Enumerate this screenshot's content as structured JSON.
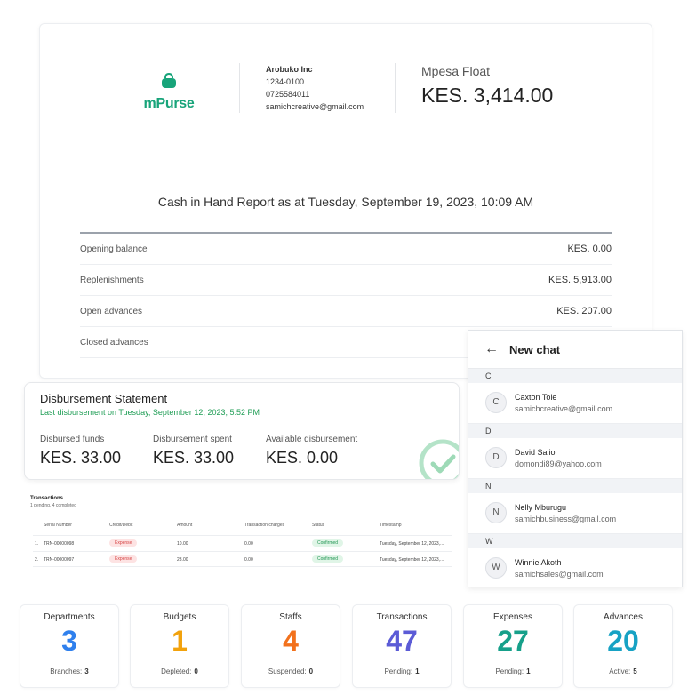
{
  "report": {
    "logo_text": "mPurse",
    "company": {
      "name": "Arobuko Inc",
      "box": "1234-0100",
      "phone": "0725584011",
      "email": "samichcreative@gmail.com"
    },
    "float_label": "Mpesa Float",
    "float_value": "KES. 3,414.00",
    "title": "Cash in Hand Report as at Tuesday, September 19, 2023, 10:09 AM",
    "rows": [
      {
        "label": "Opening balance",
        "value": "KES. 0.00"
      },
      {
        "label": "Replenishments",
        "value": "KES. 5,913.00"
      },
      {
        "label": "Open advances",
        "value": "KES. 207.00"
      },
      {
        "label": "Closed advances",
        "value": ""
      }
    ]
  },
  "disbursement": {
    "title": "Disbursement Statement",
    "subtitle": "Last disbursement on Tuesday, September 12, 2023, 5:52 PM",
    "stats": [
      {
        "label": "Disbursed funds",
        "value": "KES. 33.00"
      },
      {
        "label": "Disbursement spent",
        "value": "KES. 33.00"
      },
      {
        "label": "Available disbursement",
        "value": "KES. 0.00"
      }
    ],
    "check_color": "#27ae60"
  },
  "transactions": {
    "title": "Transactions",
    "subtitle": "1 pending, 4 completed",
    "columns": [
      "Serial Number",
      "Credit/Debit",
      "Amount",
      "Transaction charges",
      "Status",
      "Timestamp"
    ],
    "rows": [
      {
        "index": "1.",
        "serial": "TRN-00000098",
        "type": "Expense",
        "amount": "10.00",
        "charges": "0.00",
        "status": "Confirmed",
        "timestamp": "Tuesday, September 12, 2023,..."
      },
      {
        "index": "2.",
        "serial": "TRN-00000097",
        "type": "Expense",
        "amount": "23.00",
        "charges": "0.00",
        "status": "Confirmed",
        "timestamp": "Tuesday, September 12, 2023,..."
      }
    ]
  },
  "chat": {
    "back_icon": "arrow-left-icon",
    "title": "New chat",
    "sections": [
      {
        "letter": "C",
        "contact": {
          "initial": "C",
          "name": "Caxton Tole",
          "email": "samichcreative@gmail.com"
        }
      },
      {
        "letter": "D",
        "contact": {
          "initial": "D",
          "name": "David Salio",
          "email": "domondi89@yahoo.com"
        }
      },
      {
        "letter": "N",
        "contact": {
          "initial": "N",
          "name": "Nelly Mburugu",
          "email": "samichbusiness@gmail.com"
        }
      },
      {
        "letter": "W",
        "contact": {
          "initial": "W",
          "name": "Winnie Akoth",
          "email": "samichsales@gmail.com"
        }
      }
    ]
  },
  "stats": [
    {
      "title": "Departments",
      "value": "3",
      "color": "#2f80ed",
      "footer_label": "Branches:",
      "footer_value": "3"
    },
    {
      "title": "Budgets",
      "value": "1",
      "color": "#f2a20c",
      "footer_label": "Depleted:",
      "footer_value": "0"
    },
    {
      "title": "Staffs",
      "value": "4",
      "color": "#f2711c",
      "footer_label": "Suspended:",
      "footer_value": "0"
    },
    {
      "title": "Transactions",
      "value": "47",
      "color": "#5b5bd6",
      "footer_label": "Pending:",
      "footer_value": "1"
    },
    {
      "title": "Expenses",
      "value": "27",
      "color": "#16a08a",
      "footer_label": "Pending:",
      "footer_value": "1"
    },
    {
      "title": "Advances",
      "value": "20",
      "color": "#17a2c4",
      "footer_label": "Active:",
      "footer_value": "5"
    }
  ]
}
